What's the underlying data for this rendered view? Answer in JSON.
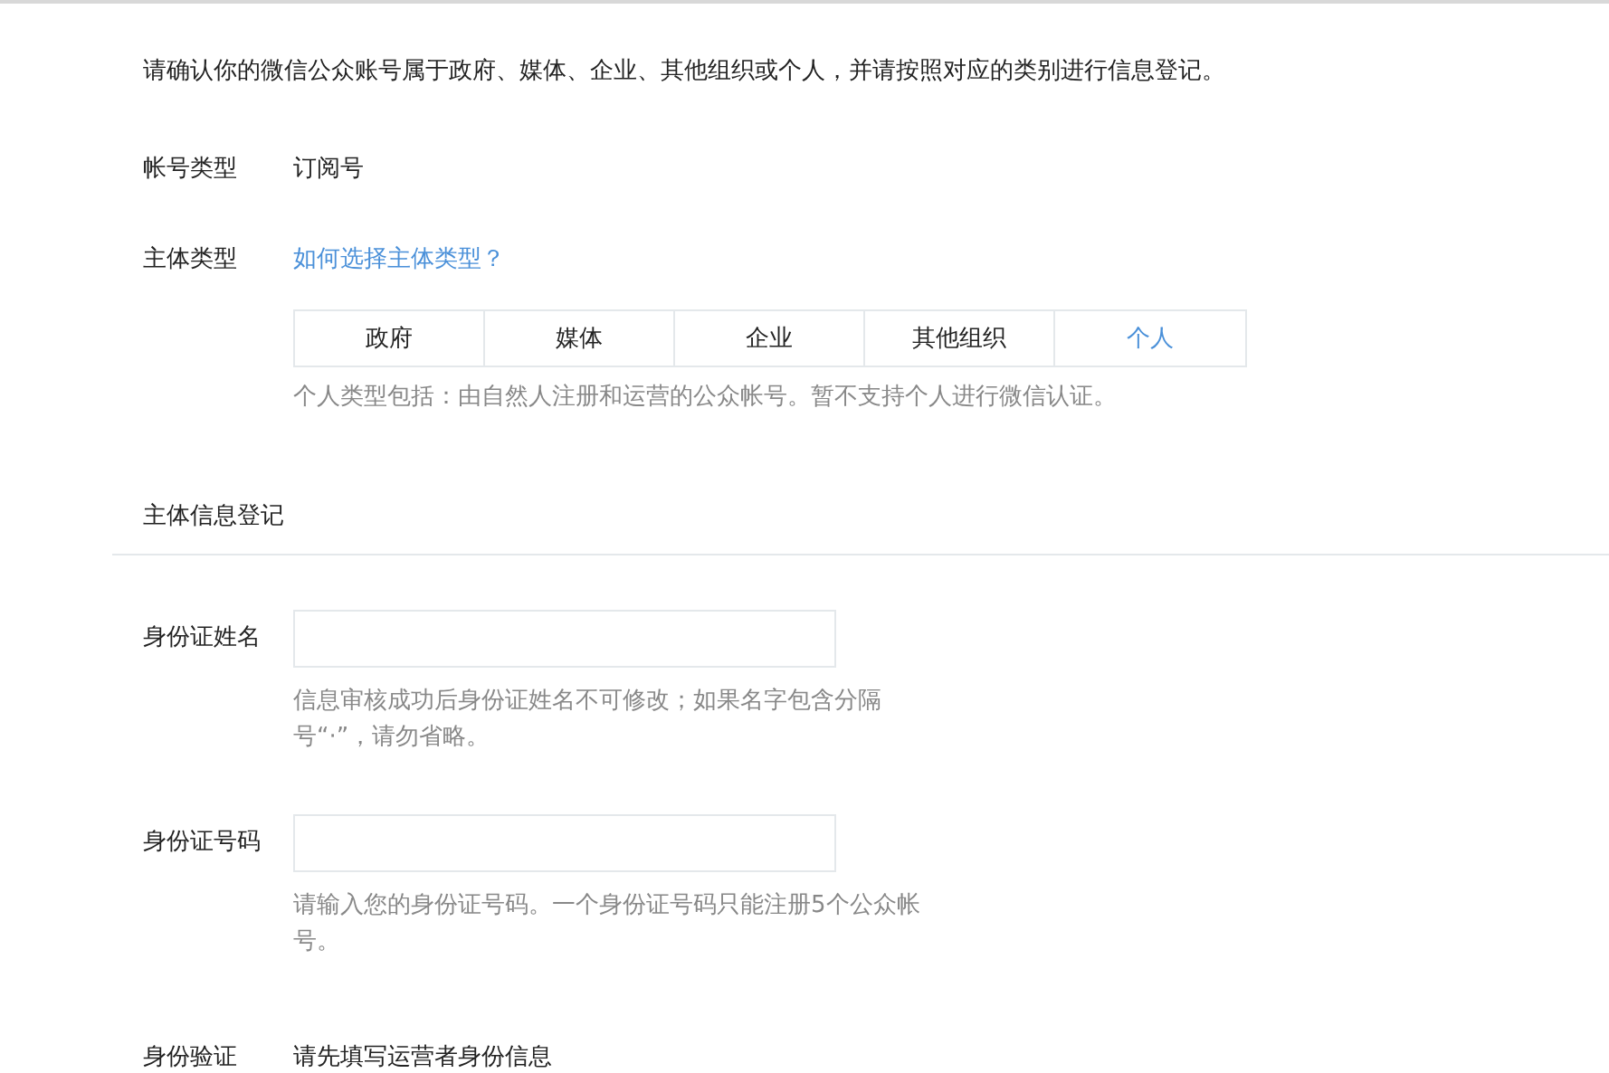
{
  "intro": "请确认你的微信公众账号属于政府、媒体、企业、其他组织或个人，并请按照对应的类别进行信息登记。",
  "account_type": {
    "label": "帐号类型",
    "value": "订阅号"
  },
  "subject_type": {
    "label": "主体类型",
    "help_link": "如何选择主体类型？",
    "tabs": [
      {
        "label": "政府",
        "selected": false
      },
      {
        "label": "媒体",
        "selected": false
      },
      {
        "label": "企业",
        "selected": false
      },
      {
        "label": "其他组织",
        "selected": false
      },
      {
        "label": "个人",
        "selected": true
      }
    ],
    "hint": "个人类型包括：由自然人注册和运营的公众帐号。暂不支持个人进行微信认证。"
  },
  "section_title": "主体信息登记",
  "fields": [
    {
      "label": "身份证姓名",
      "hint": "信息审核成功后身份证姓名不可修改；如果名字包含分隔号“·”，请勿省略。"
    },
    {
      "label": "身份证号码",
      "hint": "请输入您的身份证号码。一个身份证号码只能注册5个公众帐号。"
    }
  ],
  "verification": {
    "label": "身份验证",
    "value": "请先填写运营者身份信息"
  }
}
